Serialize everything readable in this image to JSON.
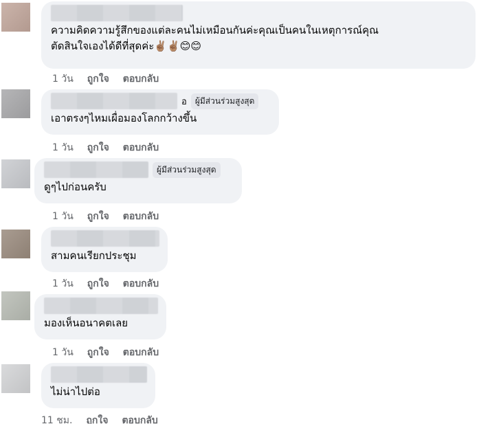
{
  "comments": [
    {
      "text": "ความคิดความรู้สึกของแต่ละคนไม่เหมือนกันค่ะคุณเป็นคนในเหตุการณ์คุณ",
      "text2": "ตัดสินใจเองได้ดีที่สุดค่ะ",
      "emojis": "✌🏽✌🏽😊😊",
      "badge": "",
      "time": "1 วัน",
      "like": "ถูกใจ",
      "reply": "ตอบกลับ",
      "avatar_color": "#c2a79c"
    },
    {
      "text": "เอาตรงๆไหมเผื่อมองโลกกว้างขึ้น",
      "badge": "ผู้มีส่วนร่วมสูงสุด",
      "name_fragment": "อ",
      "time": "1 วัน",
      "like": "ถูกใจ",
      "reply": "ตอบกลับ",
      "avatar_color": "#a9a9ab"
    },
    {
      "text": "ดูๆไปก่อนครับ",
      "badge": "ผู้มีส่วนร่วมสูงสุด",
      "time": "1 วัน",
      "like": "ถูกใจ",
      "reply": "ตอบกลับ",
      "avatar_color": "#c9cbcf"
    },
    {
      "text": "สามคนเรียกประชุม",
      "badge": "",
      "time": "1 วัน",
      "like": "ถูกใจ",
      "reply": "ตอบกลับ",
      "avatar_color": "#9a8b7e"
    },
    {
      "text": "มองเห็นอนาคตเลย",
      "badge": "",
      "time": "1 วัน",
      "like": "ถูกใจ",
      "reply": "ตอบกลับ",
      "avatar_color": "#b8bcb4"
    },
    {
      "text": "ไม่น่าไปต่อ",
      "badge": "",
      "time": "11 ชม.",
      "like": "ถูกใจ",
      "reply": "ตอบกลับ",
      "avatar_color": "#d3d4d6"
    }
  ]
}
